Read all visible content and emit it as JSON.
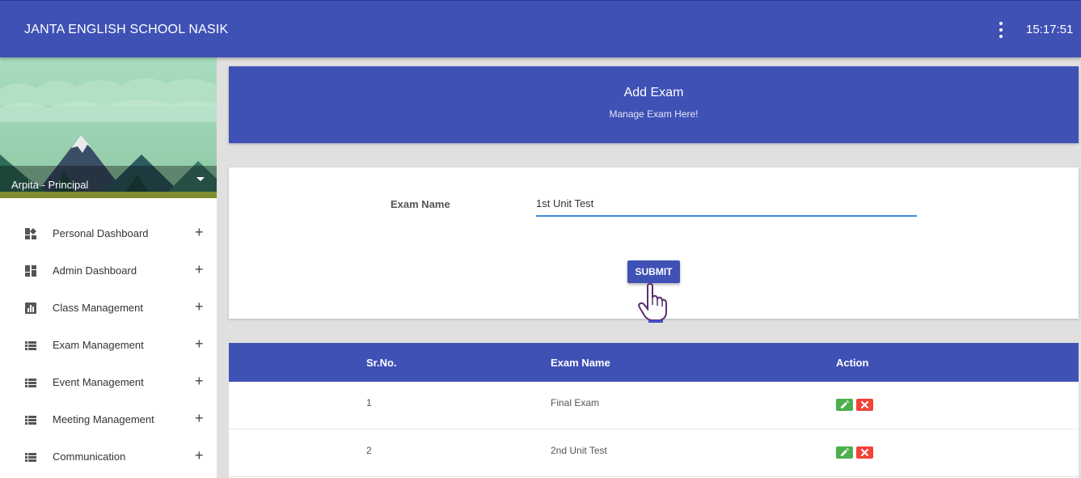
{
  "app": {
    "title": "JANTA ENGLISH SCHOOL NASIK",
    "clock": "15:17:51"
  },
  "sidebar": {
    "user": "Arpita - Principal",
    "items": [
      {
        "label": "Personal Dashboard",
        "icon": "dashboard-icon"
      },
      {
        "label": "Admin Dashboard",
        "icon": "dashboard-icon"
      },
      {
        "label": "Class Management",
        "icon": "bar-chart-icon"
      },
      {
        "label": "Exam Management",
        "icon": "list-icon"
      },
      {
        "label": "Event Management",
        "icon": "list-icon"
      },
      {
        "label": "Meeting Management",
        "icon": "list-icon"
      },
      {
        "label": "Communication",
        "icon": "list-icon"
      }
    ]
  },
  "header": {
    "title": "Add Exam",
    "subtitle": "Manage Exam Here!"
  },
  "form": {
    "label": "Exam Name",
    "value": "1st Unit Test",
    "submit_label": "SUBMIT"
  },
  "table": {
    "columns": [
      "Sr.No.",
      "Exam Name",
      "Action"
    ],
    "rows": [
      {
        "sr": "1",
        "name": "Final Exam"
      },
      {
        "sr": "2",
        "name": "2nd Unit Test"
      }
    ]
  },
  "colors": {
    "primary": "#3f51b5",
    "edit": "#4caf50",
    "delete": "#f44336",
    "input_underline": "#3c8be0"
  }
}
